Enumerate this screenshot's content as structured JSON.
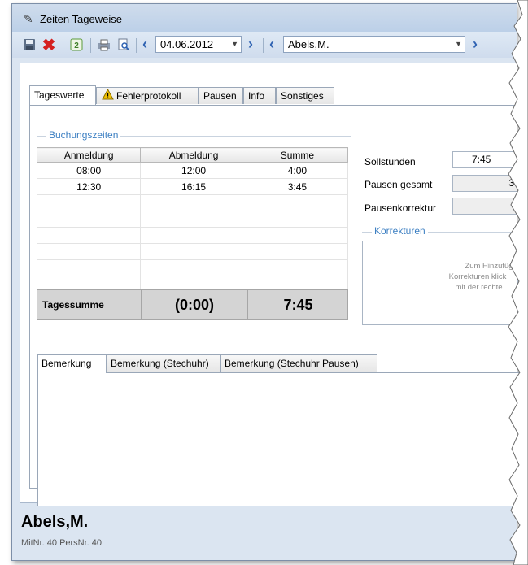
{
  "window": {
    "title": "Zeiten Tageweise"
  },
  "toolbar": {
    "date": "04.06.2012",
    "employee": "Abels,M."
  },
  "tabs": [
    "Tageswerte",
    "Fehlerprotokoll",
    "Pausen",
    "Info",
    "Sonstiges"
  ],
  "buchungszeiten": {
    "group_label": "Buchungszeiten",
    "columns": [
      "Anmeldung",
      "Abmeldung",
      "Summe"
    ],
    "rows": [
      [
        "08:00",
        "12:00",
        "4:00"
      ],
      [
        "12:30",
        "16:15",
        "3:45"
      ],
      [
        "",
        "",
        ""
      ],
      [
        "",
        "",
        ""
      ],
      [
        "",
        "",
        ""
      ],
      [
        "",
        "",
        ""
      ],
      [
        "",
        "",
        ""
      ],
      [
        "",
        "",
        ""
      ]
    ],
    "total_label": "Tagessumme",
    "total_pause": "(0:00)",
    "total_sum": "7:45"
  },
  "side": {
    "sollstunden_label": "Sollstunden",
    "sollstunden_value": "7:45",
    "pausen_label": "Pausen gesamt",
    "pausen_value": "3",
    "pausenkorrektur_label": "Pausenkorrektur",
    "pausenkorrektur_value": "",
    "korrekturen_label": "Korrekturen",
    "korrekturen_hint_1": "Zum Hinzufüg",
    "korrekturen_hint_2": "Korrekturen klick",
    "korrekturen_hint_3": "mit der rechte"
  },
  "bemerkung_tabs": [
    "Bemerkung",
    "Bemerkung (Stechuhr)",
    "Bemerkung (Stechuhr Pausen)"
  ],
  "footer": {
    "name": "Abels,M.",
    "sub": "MitNr. 40   PersNr. 40"
  },
  "colors": {
    "accent": "#3c7fc2",
    "delete": "#d42020",
    "nav": "#2f62b2",
    "warning": "#f2c200"
  }
}
